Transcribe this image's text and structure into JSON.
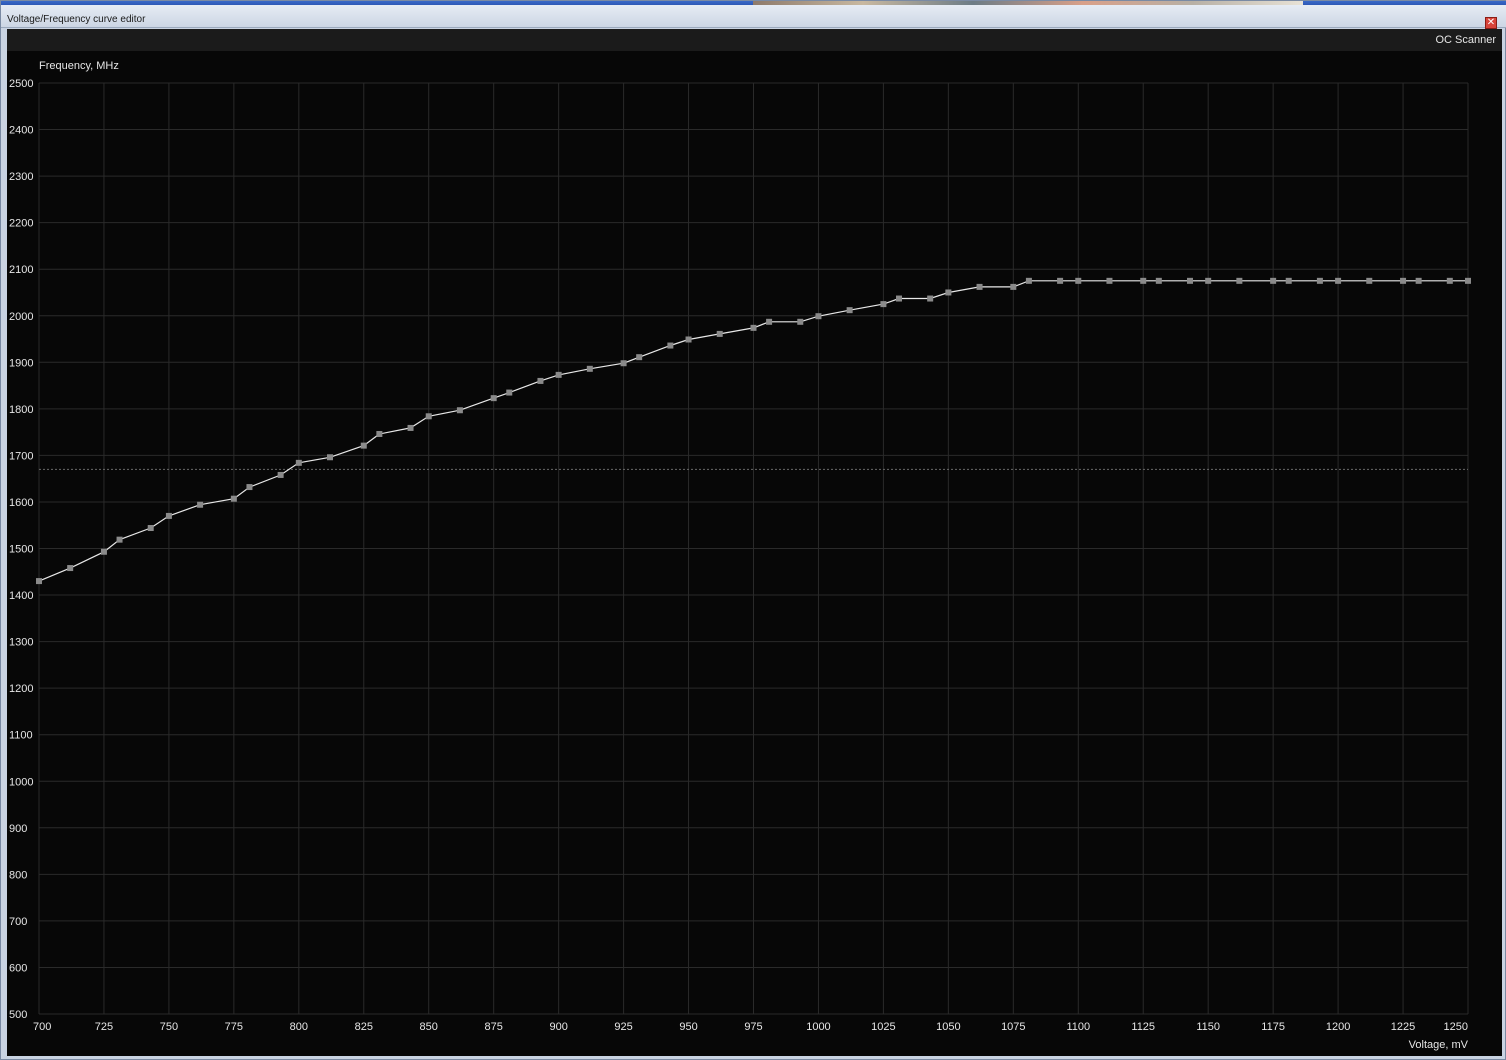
{
  "window": {
    "title": "Voltage/Frequency curve editor",
    "close_glyph": "✕",
    "close_icon": "close-icon"
  },
  "toolbar": {
    "oc_scanner_label": "OC Scanner"
  },
  "colors": {
    "panel_bg": "#070707",
    "grid": "#2a2a2a",
    "curve": "#e8e8e8",
    "point": "#8a8a8a",
    "text": "#e6e6e6",
    "dotted_line": "#6a6a6a"
  },
  "chart_data": {
    "type": "line",
    "xlabel": "Voltage, mV",
    "ylabel": "Frequency, MHz",
    "xlim": [
      700,
      1250
    ],
    "ylim": [
      500,
      2500
    ],
    "x_ticks": [
      700,
      725,
      750,
      775,
      800,
      825,
      850,
      875,
      900,
      925,
      950,
      975,
      1000,
      1025,
      1050,
      1075,
      1100,
      1125,
      1150,
      1175,
      1200,
      1225,
      1250
    ],
    "y_ticks": [
      500,
      600,
      700,
      800,
      900,
      1000,
      1100,
      1200,
      1300,
      1400,
      1500,
      1600,
      1700,
      1800,
      1900,
      2000,
      2100,
      2200,
      2300,
      2400,
      2500
    ],
    "grid": true,
    "reference_line_y": 1670,
    "series": [
      {
        "points": [
          [
            700,
            1430
          ],
          [
            712,
            1458
          ],
          [
            725,
            1493
          ],
          [
            731,
            1519
          ],
          [
            743,
            1544
          ],
          [
            750,
            1570
          ],
          [
            762,
            1594
          ],
          [
            775,
            1607
          ],
          [
            781,
            1632
          ],
          [
            793,
            1658
          ],
          [
            800,
            1684
          ],
          [
            812,
            1696
          ],
          [
            825,
            1721
          ],
          [
            831,
            1746
          ],
          [
            843,
            1759
          ],
          [
            850,
            1784
          ],
          [
            862,
            1797
          ],
          [
            875,
            1823
          ],
          [
            881,
            1835
          ],
          [
            893,
            1860
          ],
          [
            900,
            1873
          ],
          [
            912,
            1886
          ],
          [
            925,
            1898
          ],
          [
            931,
            1911
          ],
          [
            943,
            1936
          ],
          [
            950,
            1949
          ],
          [
            962,
            1961
          ],
          [
            975,
            1974
          ],
          [
            981,
            1987
          ],
          [
            993,
            1987
          ],
          [
            1000,
            1999
          ],
          [
            1012,
            2012
          ],
          [
            1025,
            2025
          ],
          [
            1031,
            2037
          ],
          [
            1043,
            2037
          ],
          [
            1050,
            2050
          ],
          [
            1062,
            2062
          ],
          [
            1075,
            2062
          ],
          [
            1081,
            2075
          ],
          [
            1093,
            2075
          ],
          [
            1100,
            2075
          ],
          [
            1112,
            2075
          ],
          [
            1125,
            2075
          ],
          [
            1131,
            2075
          ],
          [
            1143,
            2075
          ],
          [
            1150,
            2075
          ],
          [
            1162,
            2075
          ],
          [
            1175,
            2075
          ],
          [
            1181,
            2075
          ],
          [
            1193,
            2075
          ],
          [
            1200,
            2075
          ],
          [
            1212,
            2075
          ],
          [
            1225,
            2075
          ],
          [
            1231,
            2075
          ],
          [
            1243,
            2075
          ],
          [
            1250,
            2075
          ]
        ]
      }
    ]
  }
}
